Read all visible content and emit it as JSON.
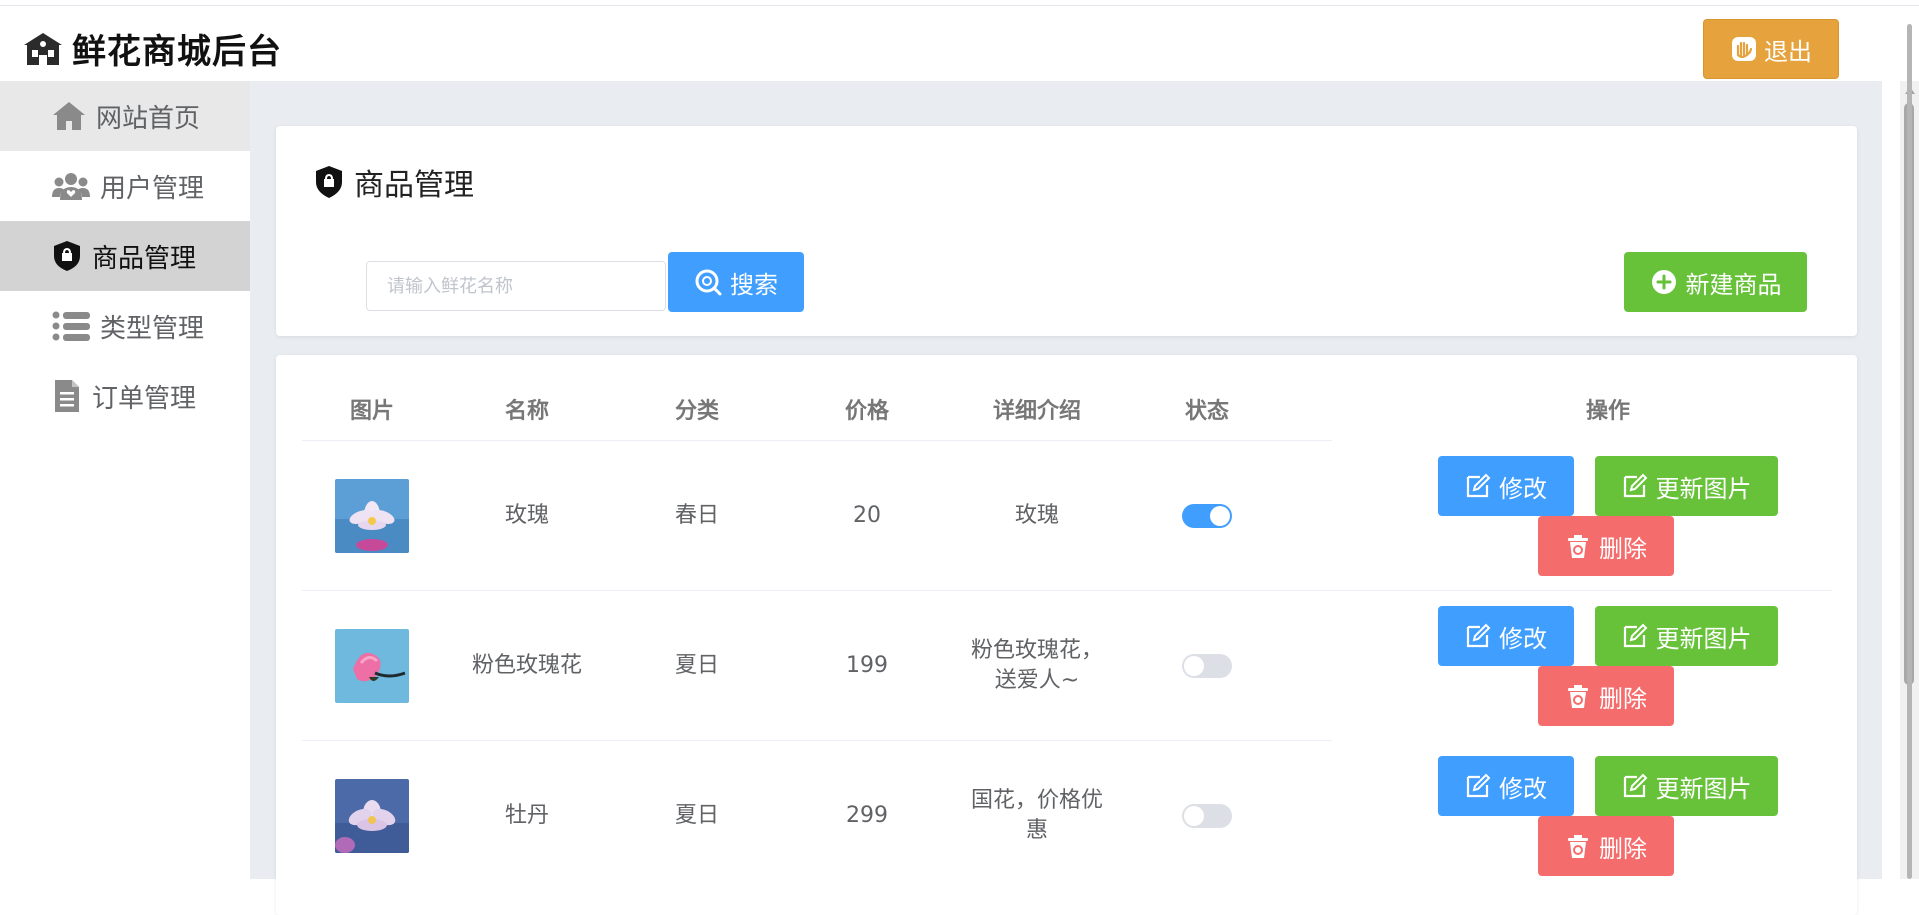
{
  "app": {
    "title": "鲜花商城后台",
    "logout_label": "退出"
  },
  "sidebar": {
    "items": [
      {
        "label": "网站首页",
        "icon": "home-icon"
      },
      {
        "label": "用户管理",
        "icon": "users-icon"
      },
      {
        "label": "商品管理",
        "icon": "goods-shield-icon",
        "active": true
      },
      {
        "label": "类型管理",
        "icon": "list-icon"
      },
      {
        "label": "订单管理",
        "icon": "document-icon"
      }
    ]
  },
  "main": {
    "title": "商品管理",
    "search": {
      "placeholder": "请输入鲜花名称",
      "value": "",
      "button_label": "搜索"
    },
    "new_button_label": "新建商品"
  },
  "table": {
    "columns": [
      "图片",
      "名称",
      "分类",
      "价格",
      "详细介绍",
      "状态",
      "操作"
    ],
    "rows": [
      {
        "name": "玫瑰",
        "category": "春日",
        "price": "20",
        "detail": "玫瑰",
        "status": true,
        "image": "lotus-flower-blue"
      },
      {
        "name": "粉色玫瑰花",
        "category": "夏日",
        "price": "199",
        "detail_line1": "粉色玫瑰花，",
        "detail_line2": "送爱人~",
        "status": false,
        "image": "pink-bud-blue"
      },
      {
        "name": "牡丹",
        "category": "夏日",
        "price": "299",
        "detail_line1": "国花，价格优",
        "detail_line2": "惠",
        "status": false,
        "image": "lotus-flower-purple"
      }
    ],
    "actions": {
      "edit_label": "修改",
      "update_image_label": "更新图片",
      "delete_label": "删除"
    }
  },
  "colors": {
    "primary": "#409eff",
    "success": "#67c23a",
    "warning": "#e6a23c",
    "danger": "#f56c6c",
    "main_bg": "#e9edf1"
  }
}
